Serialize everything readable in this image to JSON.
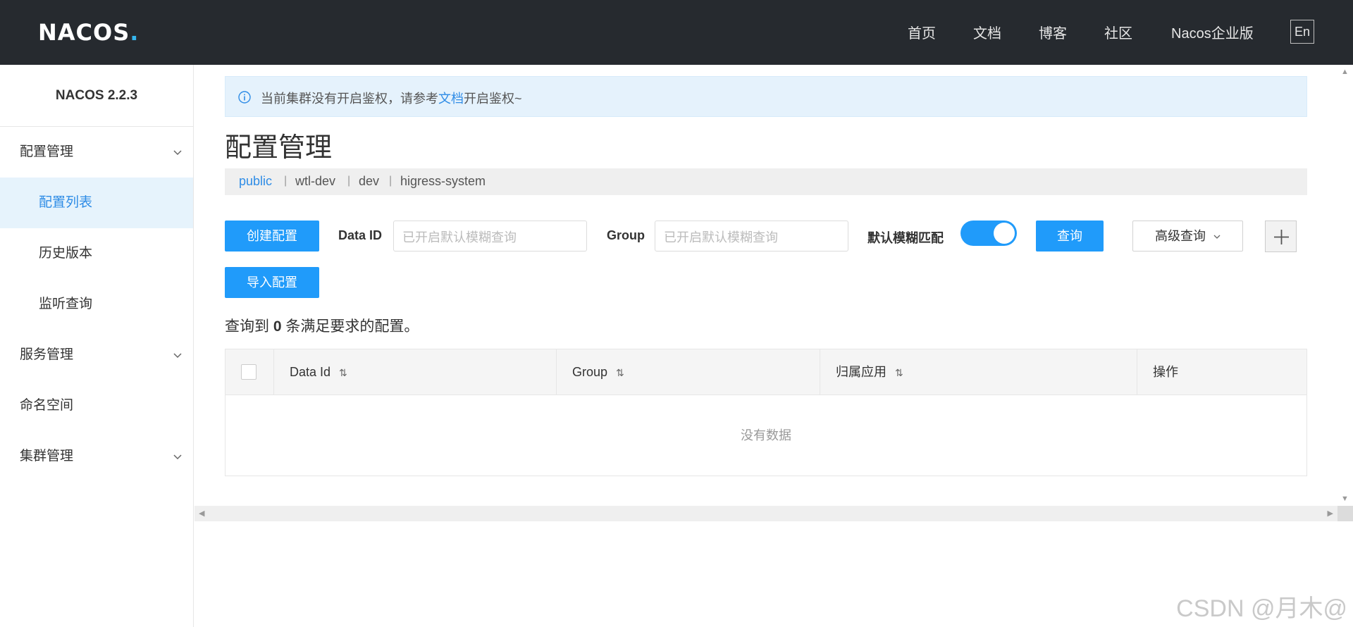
{
  "header": {
    "logo": "NACOS",
    "logo_dot": ".",
    "nav": [
      "首页",
      "文档",
      "博客",
      "社区",
      "Nacos企业版"
    ],
    "lang": "En"
  },
  "sidebar": {
    "version": "NACOS 2.2.3",
    "items": [
      {
        "label": "配置管理",
        "type": "group",
        "expanded": true
      },
      {
        "label": "配置列表",
        "type": "sub",
        "active": true
      },
      {
        "label": "历史版本",
        "type": "sub"
      },
      {
        "label": "监听查询",
        "type": "sub"
      },
      {
        "label": "服务管理",
        "type": "group"
      },
      {
        "label": "命名空间",
        "type": "item"
      },
      {
        "label": "集群管理",
        "type": "group"
      }
    ]
  },
  "alert": {
    "text_before": "当前集群没有开启鉴权，请参考",
    "link": "文档",
    "text_after": "开启鉴权~"
  },
  "page_title": "配置管理",
  "namespaces": [
    "public",
    "wtl-dev",
    "dev",
    "higress-system"
  ],
  "toolbar": {
    "create_label": "创建配置",
    "dataid_label": "Data ID",
    "dataid_placeholder": "已开启默认模糊查询",
    "group_label": "Group",
    "group_placeholder": "已开启默认模糊查询",
    "fuzzy_label": "默认模糊匹配",
    "fuzzy_on": true,
    "query_label": "查询",
    "advanced_label": "高级查询",
    "import_label": "导入配置"
  },
  "result": {
    "prefix": "查询到",
    "count": "0",
    "suffix": "条满足要求的配置。"
  },
  "table": {
    "columns": [
      "Data Id",
      "Group",
      "归属应用",
      "操作"
    ],
    "empty_text": "没有数据"
  },
  "watermark": "CSDN @月木@",
  "colors": {
    "header_bg": "#262a2f",
    "primary": "#209bfa",
    "link": "#2e8ce6",
    "alert_bg": "#e5f2fc"
  }
}
